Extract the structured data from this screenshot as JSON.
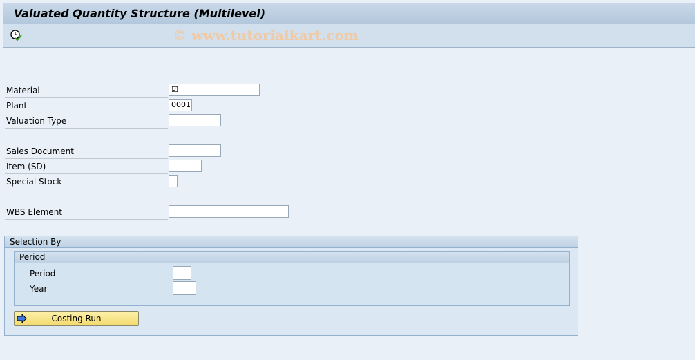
{
  "title": "Valuated Quantity Structure (Multilevel)",
  "watermark": "© www.tutorialkart.com",
  "fields": {
    "material": {
      "label": "Material",
      "value": ""
    },
    "plant": {
      "label": "Plant",
      "value": "0001"
    },
    "valuation_type": {
      "label": "Valuation Type",
      "value": ""
    },
    "sales_document": {
      "label": "Sales Document",
      "value": ""
    },
    "item_sd": {
      "label": "Item (SD)",
      "value": ""
    },
    "special_stock": {
      "label": "Special Stock",
      "value": ""
    },
    "wbs_element": {
      "label": "WBS Element",
      "value": ""
    }
  },
  "selection": {
    "title": "Selection By",
    "period_group": "Period",
    "period_label": "Period",
    "year_label": "Year",
    "button": "Costing Run"
  }
}
